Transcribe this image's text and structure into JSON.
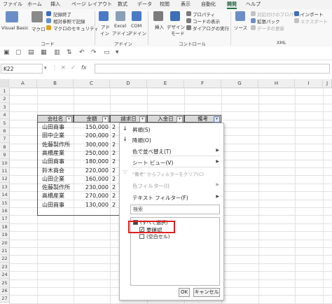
{
  "ribbon_tabs": [
    "ファイル",
    "ホーム",
    "挿入",
    "ページ レイアウト",
    "数式",
    "データ",
    "校閲",
    "表示",
    "自動化",
    "開発",
    "ヘルプ"
  ],
  "ribbon": {
    "visual_basic": "Visual Basic",
    "macro": "マクロ",
    "record_macro": "記録終了",
    "relative_ref": "相対参照で記録",
    "macro_security": "マクロのセキュリティ",
    "group_code": "コード",
    "addins": [
      "アド",
      "イン"
    ],
    "excel_addins": [
      "Excel",
      "アドイン"
    ],
    "com_addins": [
      "COM",
      "アドイン"
    ],
    "group_addins": "アドイン",
    "insert": "挿入",
    "design_mode": [
      "デザイン",
      "モード"
    ],
    "properties": "プロパティ",
    "view_code": "コードの表示",
    "run_dialog": "ダイアログの実行",
    "group_controls": "コントロール",
    "source": "ソース",
    "map_properties": "対応付けのプロパティ",
    "expansion_pack": "拡張パック",
    "refresh_data": "データの更新",
    "import": "インポート",
    "export": "エクスポート",
    "group_xml": "XML"
  },
  "formula_bar": {
    "name_box": "K22",
    "cancel": "✕",
    "enter": "✓",
    "fx": "fx"
  },
  "columns": [
    "A",
    "B",
    "C",
    "D",
    "E",
    "F",
    "G",
    "H",
    "I",
    "J"
  ],
  "rows": [
    "1",
    "2",
    "3",
    "4",
    "5",
    "6",
    "7",
    "8",
    "9",
    "10",
    "11",
    "12",
    "13",
    "14",
    "15",
    "16",
    "17",
    "18",
    "19",
    "20",
    "21",
    "22",
    "23",
    "24",
    "25",
    "26",
    "27"
  ],
  "table": {
    "headers": [
      "会社名",
      "金額",
      "請求日",
      "入金日",
      "備考"
    ],
    "companies": [
      "山田商事",
      "田中企業",
      "佐藤製作所",
      "高橋産業",
      "山田商事",
      "鈴木商会",
      "山田企業",
      "佐藤製作所",
      "高橋産業",
      "山田商事"
    ],
    "amounts": [
      "150,000",
      "200,000",
      "300,000",
      "250,000",
      "180,000",
      "220,000",
      "160,000",
      "230,000",
      "270,000",
      "130,000"
    ],
    "date_prefix": "2"
  },
  "filter_menu": {
    "sort_asc": "昇順(S)",
    "sort_desc": "降順(O)",
    "sort_color": "色で並べ替え(T)",
    "sheet_view": "シート ビュー(V)",
    "clear_filter": "\"備考\" からフィルターをクリア(C)",
    "color_filter": "色フィルター(I)",
    "text_filter": "テキスト フィルター(F)",
    "search_placeholder": "検索",
    "select_all": "(すべて選択)",
    "item_1": "要確認",
    "item_blank": "(空白セル)",
    "ok": "OK",
    "cancel": "キャンセル"
  },
  "colors": {
    "accent": "#217346",
    "highlight": "#e02020",
    "header_fill": "#d9d9d9"
  }
}
